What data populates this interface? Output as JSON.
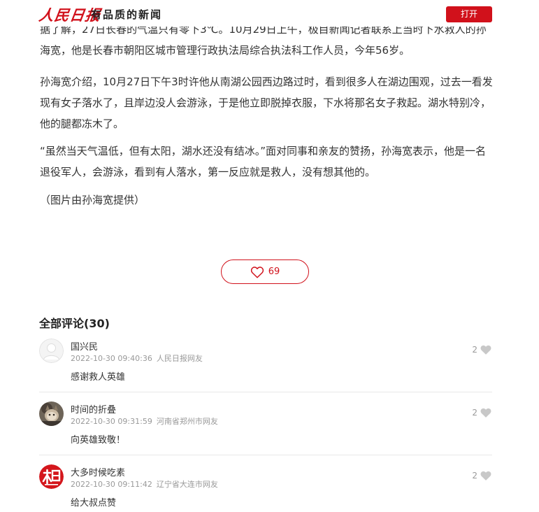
{
  "header": {
    "logo_text": "人民日报",
    "slogan": "有品质的新闻",
    "open_label": "打开"
  },
  "article": {
    "paragraphs": [
      "据了解，27日长春的气温只有零下3℃。10月29日上午，极目新闻记者联系上当时下水救人的孙海宽，他是长春市朝阳区城市管理行政执法局综合执法科工作人员，今年56岁。",
      "孙海宽介绍，10月27日下午3时许他从南湖公园西边路过时，看到很多人在湖边围观，过去一看发现有女子落水了，且岸边没人会游泳，于是他立即脱掉衣服，下水将那名女子救起。湖水特别冷，他的腿都冻木了。",
      "“虽然当天气温低，但有太阳，湖水还没有结冰。”面对同事和亲友的赞扬，孙海宽表示，他是一名退役军人，会游泳，看到有人落水，第一反应就是救人，没有想其他的。",
      "（图片由孙海宽提供）"
    ]
  },
  "like": {
    "count": "69",
    "icon": "heart-outline-icon",
    "color": "#d1111b"
  },
  "comments": {
    "title": "全部评论(30)",
    "items": [
      {
        "name": "国兴民",
        "time": "2022-10-30 09:40:36",
        "location": "人民日报网友",
        "text": "感谢救人英雄",
        "likes": "2",
        "avatar": "default-avatar"
      },
      {
        "name": "时间的折叠",
        "time": "2022-10-30 09:31:59",
        "location": "河南省郑州市网友",
        "text": "向英雄致敬！",
        "likes": "2",
        "avatar": "cat-photo-avatar"
      },
      {
        "name": "大多时候吃素",
        "time": "2022-10-30 09:11:42",
        "location": "辽宁省大连市网友",
        "text": "给大叔点赞",
        "likes": "2",
        "avatar": "red-logo-avatar"
      }
    ]
  },
  "colors": {
    "brand_red": "#d1111b",
    "text": "#333333",
    "meta": "#999999"
  }
}
